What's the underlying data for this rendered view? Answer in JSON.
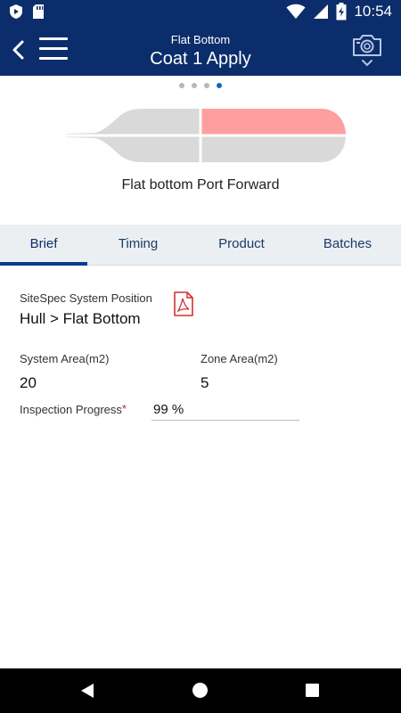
{
  "status_bar": {
    "time": "10:54",
    "icons": [
      "play-shield-icon",
      "sd-card-icon",
      "wifi-icon",
      "cellular-icon",
      "battery-charging-icon"
    ]
  },
  "app_bar": {
    "subtitle": "Flat Bottom",
    "title": "Coat 1 Apply",
    "icons": [
      "back-icon",
      "menu-icon",
      "camera-icon",
      "chevron-down-icon"
    ]
  },
  "carousel": {
    "pages": 4,
    "active_index": 3,
    "caption": "Flat bottom Port Forward",
    "highlight_color": "#ff9e9e",
    "hull_color": "#d9d9d9"
  },
  "tabs": [
    "Brief",
    "Timing",
    "Product",
    "Batches"
  ],
  "active_tab": "Brief",
  "brief": {
    "position_label": "SiteSpec System Position",
    "position_value": "Hull > Flat Bottom",
    "system_area_label": "System Area(m2)",
    "system_area_value": "20",
    "zone_area_label": "Zone Area(m2)",
    "zone_area_value": "5",
    "progress_label": "Inspection Progress",
    "progress_required": "*",
    "progress_value": "99 %"
  },
  "colors": {
    "primary": "#0b2d6b",
    "tab_bg": "#eceff1",
    "accent_dot": "#1565c0",
    "pdf_red": "#d32f2f"
  }
}
